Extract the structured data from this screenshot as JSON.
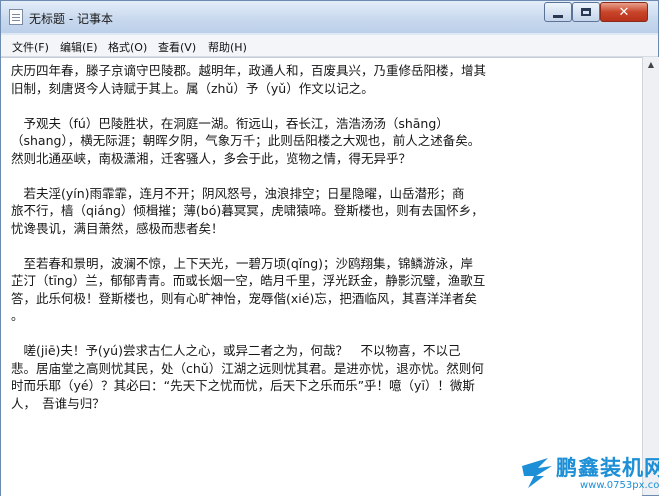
{
  "window": {
    "title": "无标题 - 记事本",
    "icon": "notepad-icon"
  },
  "menu": [
    {
      "label": "文件(F)"
    },
    {
      "label": "编辑(E)"
    },
    {
      "label": "格式(O)"
    },
    {
      "label": "查看(V)"
    },
    {
      "label": "帮助(H)"
    }
  ],
  "document": {
    "text": "庆历四年春，滕子京谪守巴陵郡。越明年，政通人和，百废具兴，乃重修岳阳楼，增其\n旧制，刻唐贤今人诗赋于其上。属（zhǔ）予（yǔ）作文以记之。\n\n　予观夫（fú）巴陵胜状，在洞庭一湖。衔远山，吞长江，浩浩汤汤（shāng）\n（shang），横无际涯；朝晖夕阴，气象万千；此则岳阳楼之大观也，前人之述备矣。\n然则北通巫峡，南极潇湘，迁客骚人，多会于此，览物之情，得无异乎？\n\n　若夫淫(yín)雨霏霏，连月不开；阴风怒号，浊浪排空；日星隐曜，山岳潜形；商\n旅不行，樯（qiáng）倾楫摧；薄(bó)暮冥冥，虎啸猿啼。登斯楼也，则有去国怀乡，\n忧谗畏讥，满目萧然，感极而悲者矣！\n\n　至若春和景明，波澜不惊，上下天光，一碧万顷(qǐng)；沙鸥翔集，锦鳞游泳，岸\n芷汀（tīng）兰，郁郁青青。而或长烟一空，皓月千里，浮光跃金，静影沉璧，渔歌互\n答，此乐何极！登斯楼也，则有心旷神怡，宠辱偕(xié)忘，把酒临风，其喜洋洋者矣\n。\n\n　嗟(jiē)夫！予(yú)尝求古仁人之心，或异二者之为，何哉？　不以物喜，不以己\n悲。居庙堂之高则忧其民，处（chǔ）江湖之远则忧其君。是进亦忧，退亦忧。然则何\n时而乐耶（yé）？其必曰：“先天下之忧而忧，后天下之乐而乐”乎！噫（yī）！微斯\n人，　吾谁与归？"
  },
  "watermark": {
    "name": "鹏鑫装机网",
    "url": "www.0753px.com"
  }
}
